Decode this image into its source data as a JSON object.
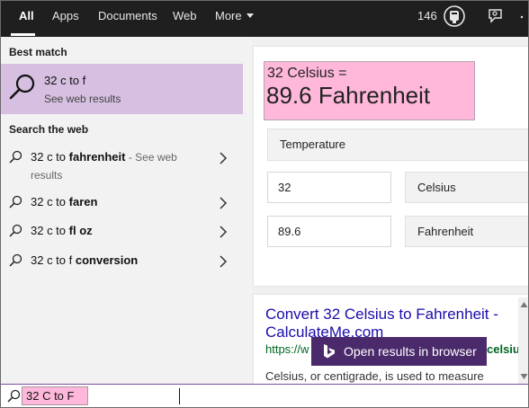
{
  "topbar": {
    "tabs": [
      {
        "label": "All",
        "active": true
      },
      {
        "label": "Apps"
      },
      {
        "label": "Documents"
      },
      {
        "label": "Web"
      },
      {
        "label": "More"
      }
    ],
    "points": "146",
    "icons": [
      "reward-icon",
      "feedback-icon",
      "more-options-icon"
    ]
  },
  "left": {
    "best_match_heading": "Best match",
    "best_match": {
      "title": "32 c to f",
      "subtitle": "See web results",
      "icon": "search-icon"
    },
    "search_web_heading": "Search the web",
    "web_items": [
      {
        "prefix": "32 c to ",
        "bold": "fahrenheit",
        "suffix": " - See web results"
      },
      {
        "prefix": "32 c to ",
        "bold": "faren",
        "suffix": ""
      },
      {
        "prefix": "32 c to ",
        "bold": "fl oz",
        "suffix": ""
      },
      {
        "prefix": "32 c to f ",
        "bold": "conversion",
        "suffix": ""
      }
    ]
  },
  "converter": {
    "headline_small": "32 Celsius =",
    "headline_big": "89.6 Fahrenheit",
    "category": "Temperature",
    "from_value": "32",
    "from_unit": "Celsius",
    "to_value": "89.6",
    "to_unit": "Fahrenheit",
    "highlight_color": "#ffb8da"
  },
  "result": {
    "title": "Convert 32 Celsius to Fahrenheit - CalculateMe.com",
    "url_start": "https://w",
    "url_end": "celsiu...",
    "snippet": "Celsius, or centigrade, is used to measure"
  },
  "open_browser_label": "Open results in browser",
  "search": {
    "value": "32 C to F"
  },
  "colors": {
    "topbar": "#1f1f1f",
    "best_match_bg": "#d6bfe0",
    "accent": "#4b2a6b",
    "link": "#1a0dab"
  }
}
